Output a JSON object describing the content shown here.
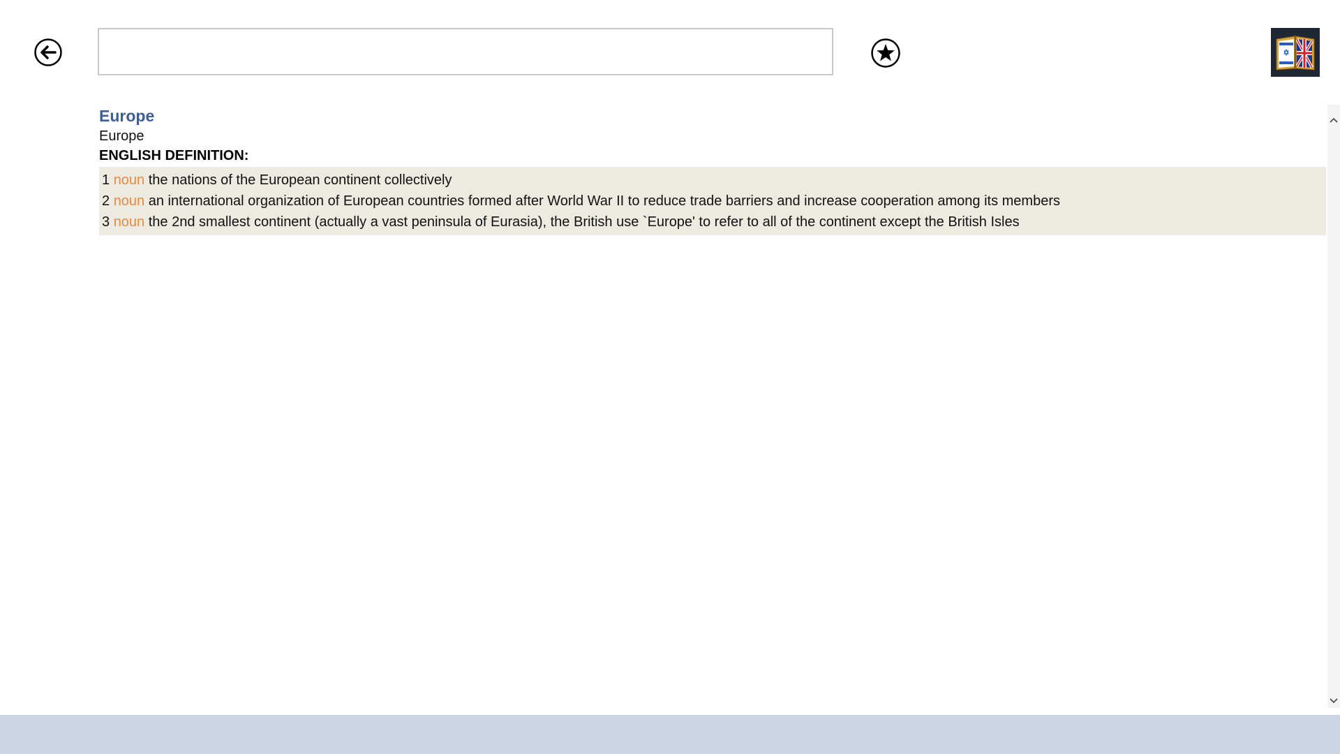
{
  "search": {
    "value": "",
    "placeholder": ""
  },
  "toolbar": {
    "back_icon": "arrow-left-circle-icon",
    "favorites_icon": "star-circle-icon",
    "logo_icon": "hebrew-english-dictionary-book-icon"
  },
  "entry": {
    "headword": "Europe",
    "translation": "Europe",
    "definition_heading": "ENGLISH DEFINITION:",
    "definitions": [
      {
        "num": "1",
        "pos": "noun",
        "text": "the nations of the European continent collectively"
      },
      {
        "num": "2",
        "pos": "noun",
        "text": "an international organization of European countries formed after World War II to reduce trade barriers and increase cooperation among its members"
      },
      {
        "num": "3",
        "pos": "noun",
        "text": "the 2nd smallest continent (actually a vast peninsula of Eurasia), the British use `Europe' to refer to all of the continent except the British Isles"
      }
    ]
  },
  "colors": {
    "headword": "#3c5f95",
    "part_of_speech": "#ea8a3a",
    "definitions_background": "#eceae1",
    "bottom_bar": "#cbd5e4",
    "logo_background": "#1e2733"
  }
}
